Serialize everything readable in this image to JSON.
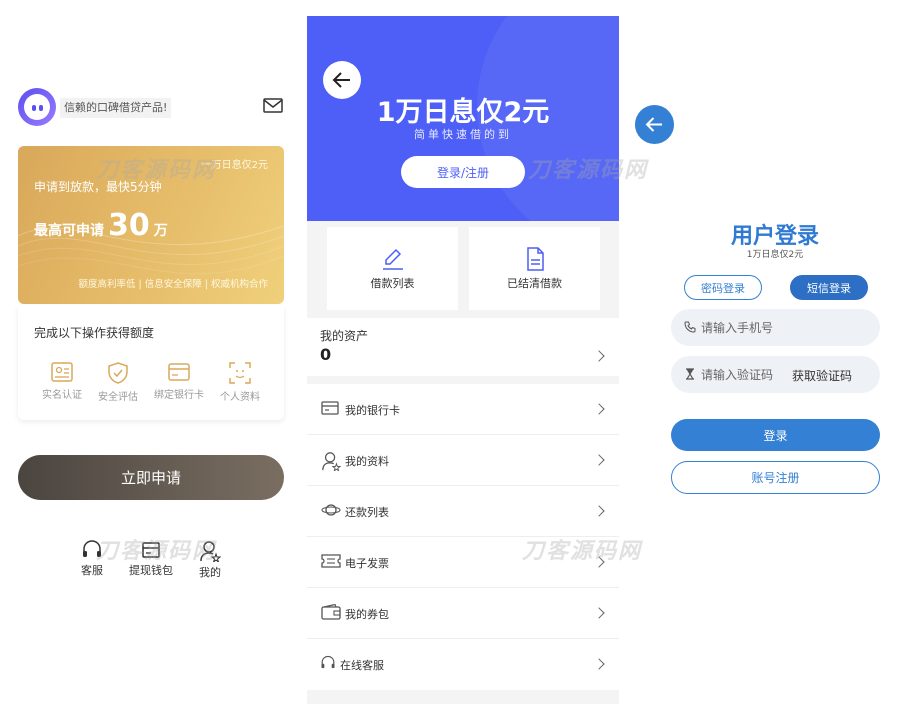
{
  "panel1": {
    "slogan": "信赖的口碑借贷产品!",
    "card": {
      "badge": "一万日息仅2元",
      "line1": "申请到放款，最快5分钟",
      "max_label": "最高可申请",
      "max_value": "30",
      "max_unit": "万",
      "features": "额度高利率低 | 信息安全保障 | 权威机构合作"
    },
    "steps": {
      "title": "完成以下操作获得额度",
      "items": [
        "实名认证",
        "安全评估",
        "绑定银行卡",
        "个人资料"
      ]
    },
    "apply_label": "立即申请",
    "nav": [
      "客服",
      "提现钱包",
      "我的"
    ],
    "accent": "#d9a85a"
  },
  "panel2": {
    "title": "1万日息仅2元",
    "subtitle": "简单快速借的到",
    "login_label": "登录/注册",
    "quick": [
      "借款列表",
      "已结清借款"
    ],
    "assets_label": "我的资产",
    "assets_value": "0",
    "menu": [
      "我的银行卡",
      "我的资料",
      "还款列表",
      "电子发票",
      "我的券包",
      "在线客服"
    ],
    "accent": "#4d5ff6"
  },
  "panel3": {
    "title": "用户登录",
    "subtitle": "1万日息仅2元",
    "tab_password": "密码登录",
    "tab_sms": "短信登录",
    "phone_placeholder": "请输入手机号",
    "code_placeholder": "请输入验证码",
    "get_code": "获取验证码",
    "login": "登录",
    "register": "账号注册",
    "accent": "#3380d4"
  },
  "watermark": "刀客源码网"
}
